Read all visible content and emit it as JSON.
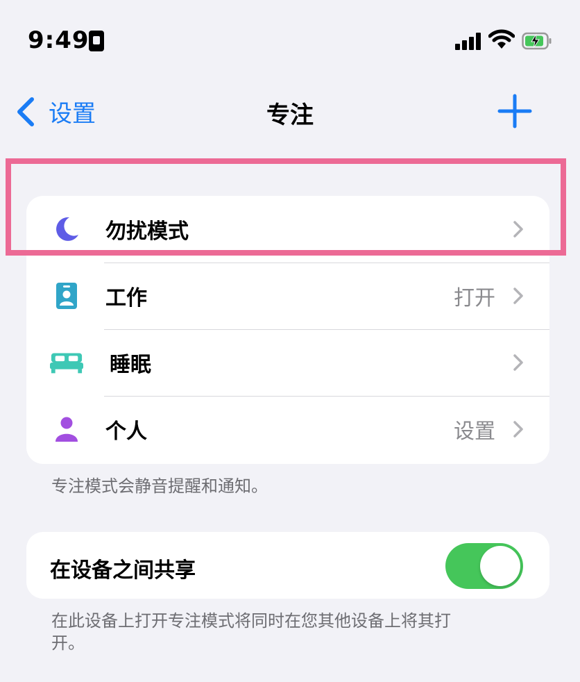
{
  "status_bar": {
    "time": "9:49"
  },
  "nav": {
    "back_label": "设置",
    "title": "专注"
  },
  "focus_modes": [
    {
      "label": "勿扰模式",
      "value": "",
      "icon": "moon-icon",
      "color": "#5e5ce6"
    },
    {
      "label": "工作",
      "value": "打开",
      "icon": "work-badge-icon",
      "color": "#30a5c8"
    },
    {
      "label": "睡眠",
      "value": "",
      "icon": "bed-icon",
      "color": "#3ec8b5"
    },
    {
      "label": "个人",
      "value": "设置",
      "icon": "person-icon",
      "color": "#a24fe0"
    }
  ],
  "focus_footnote": "专注模式会静音提醒和通知。",
  "share": {
    "label": "在设备之间共享",
    "enabled": true
  },
  "share_footnote": "在此设备上打开专注模式将同时在您其他设备上将其打开。",
  "colors": {
    "accent": "#1a7cf5",
    "toggle_on": "#45c65a",
    "highlight": "#ec6a95"
  }
}
